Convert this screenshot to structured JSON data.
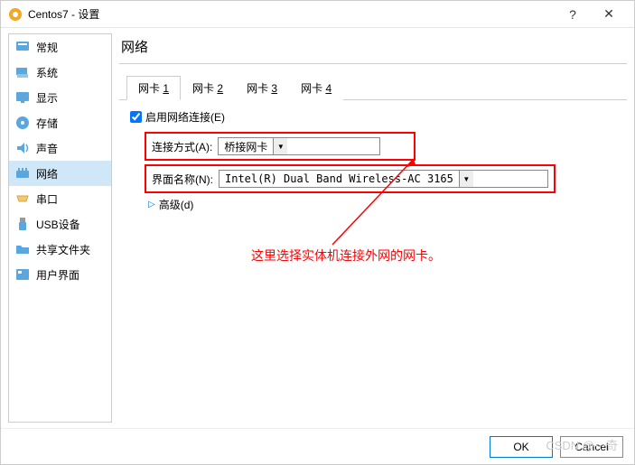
{
  "titlebar": {
    "title": "Centos7 - 设置",
    "help": "?",
    "close": "✕"
  },
  "sidebar": {
    "items": [
      {
        "label": "常规"
      },
      {
        "label": "系统"
      },
      {
        "label": "显示"
      },
      {
        "label": "存储"
      },
      {
        "label": "声音"
      },
      {
        "label": "网络"
      },
      {
        "label": "串口"
      },
      {
        "label": "USB设备"
      },
      {
        "label": "共享文件夹"
      },
      {
        "label": "用户界面"
      }
    ],
    "selected_index": 5
  },
  "page": {
    "title": "网络"
  },
  "tabs": {
    "items": [
      {
        "label": "网卡 ",
        "num": "1"
      },
      {
        "label": "网卡 ",
        "num": "2"
      },
      {
        "label": "网卡 ",
        "num": "3"
      },
      {
        "label": "网卡 ",
        "num": "4"
      }
    ],
    "active_index": 0
  },
  "form": {
    "enable_label": "启用网络连接(E)",
    "enable_checked": true,
    "connect_label": "连接方式(A):",
    "connect_value": "桥接网卡",
    "iface_label": "界面名称(N):",
    "iface_value": "Intel(R) Dual Band Wireless-AC 3165",
    "advanced_label": "高级(d)"
  },
  "annotation": "这里选择实体机连接外网的网卡。",
  "footer": {
    "ok": "OK",
    "cancel": "Cancel"
  },
  "watermark": "CSDN @⋯奇"
}
